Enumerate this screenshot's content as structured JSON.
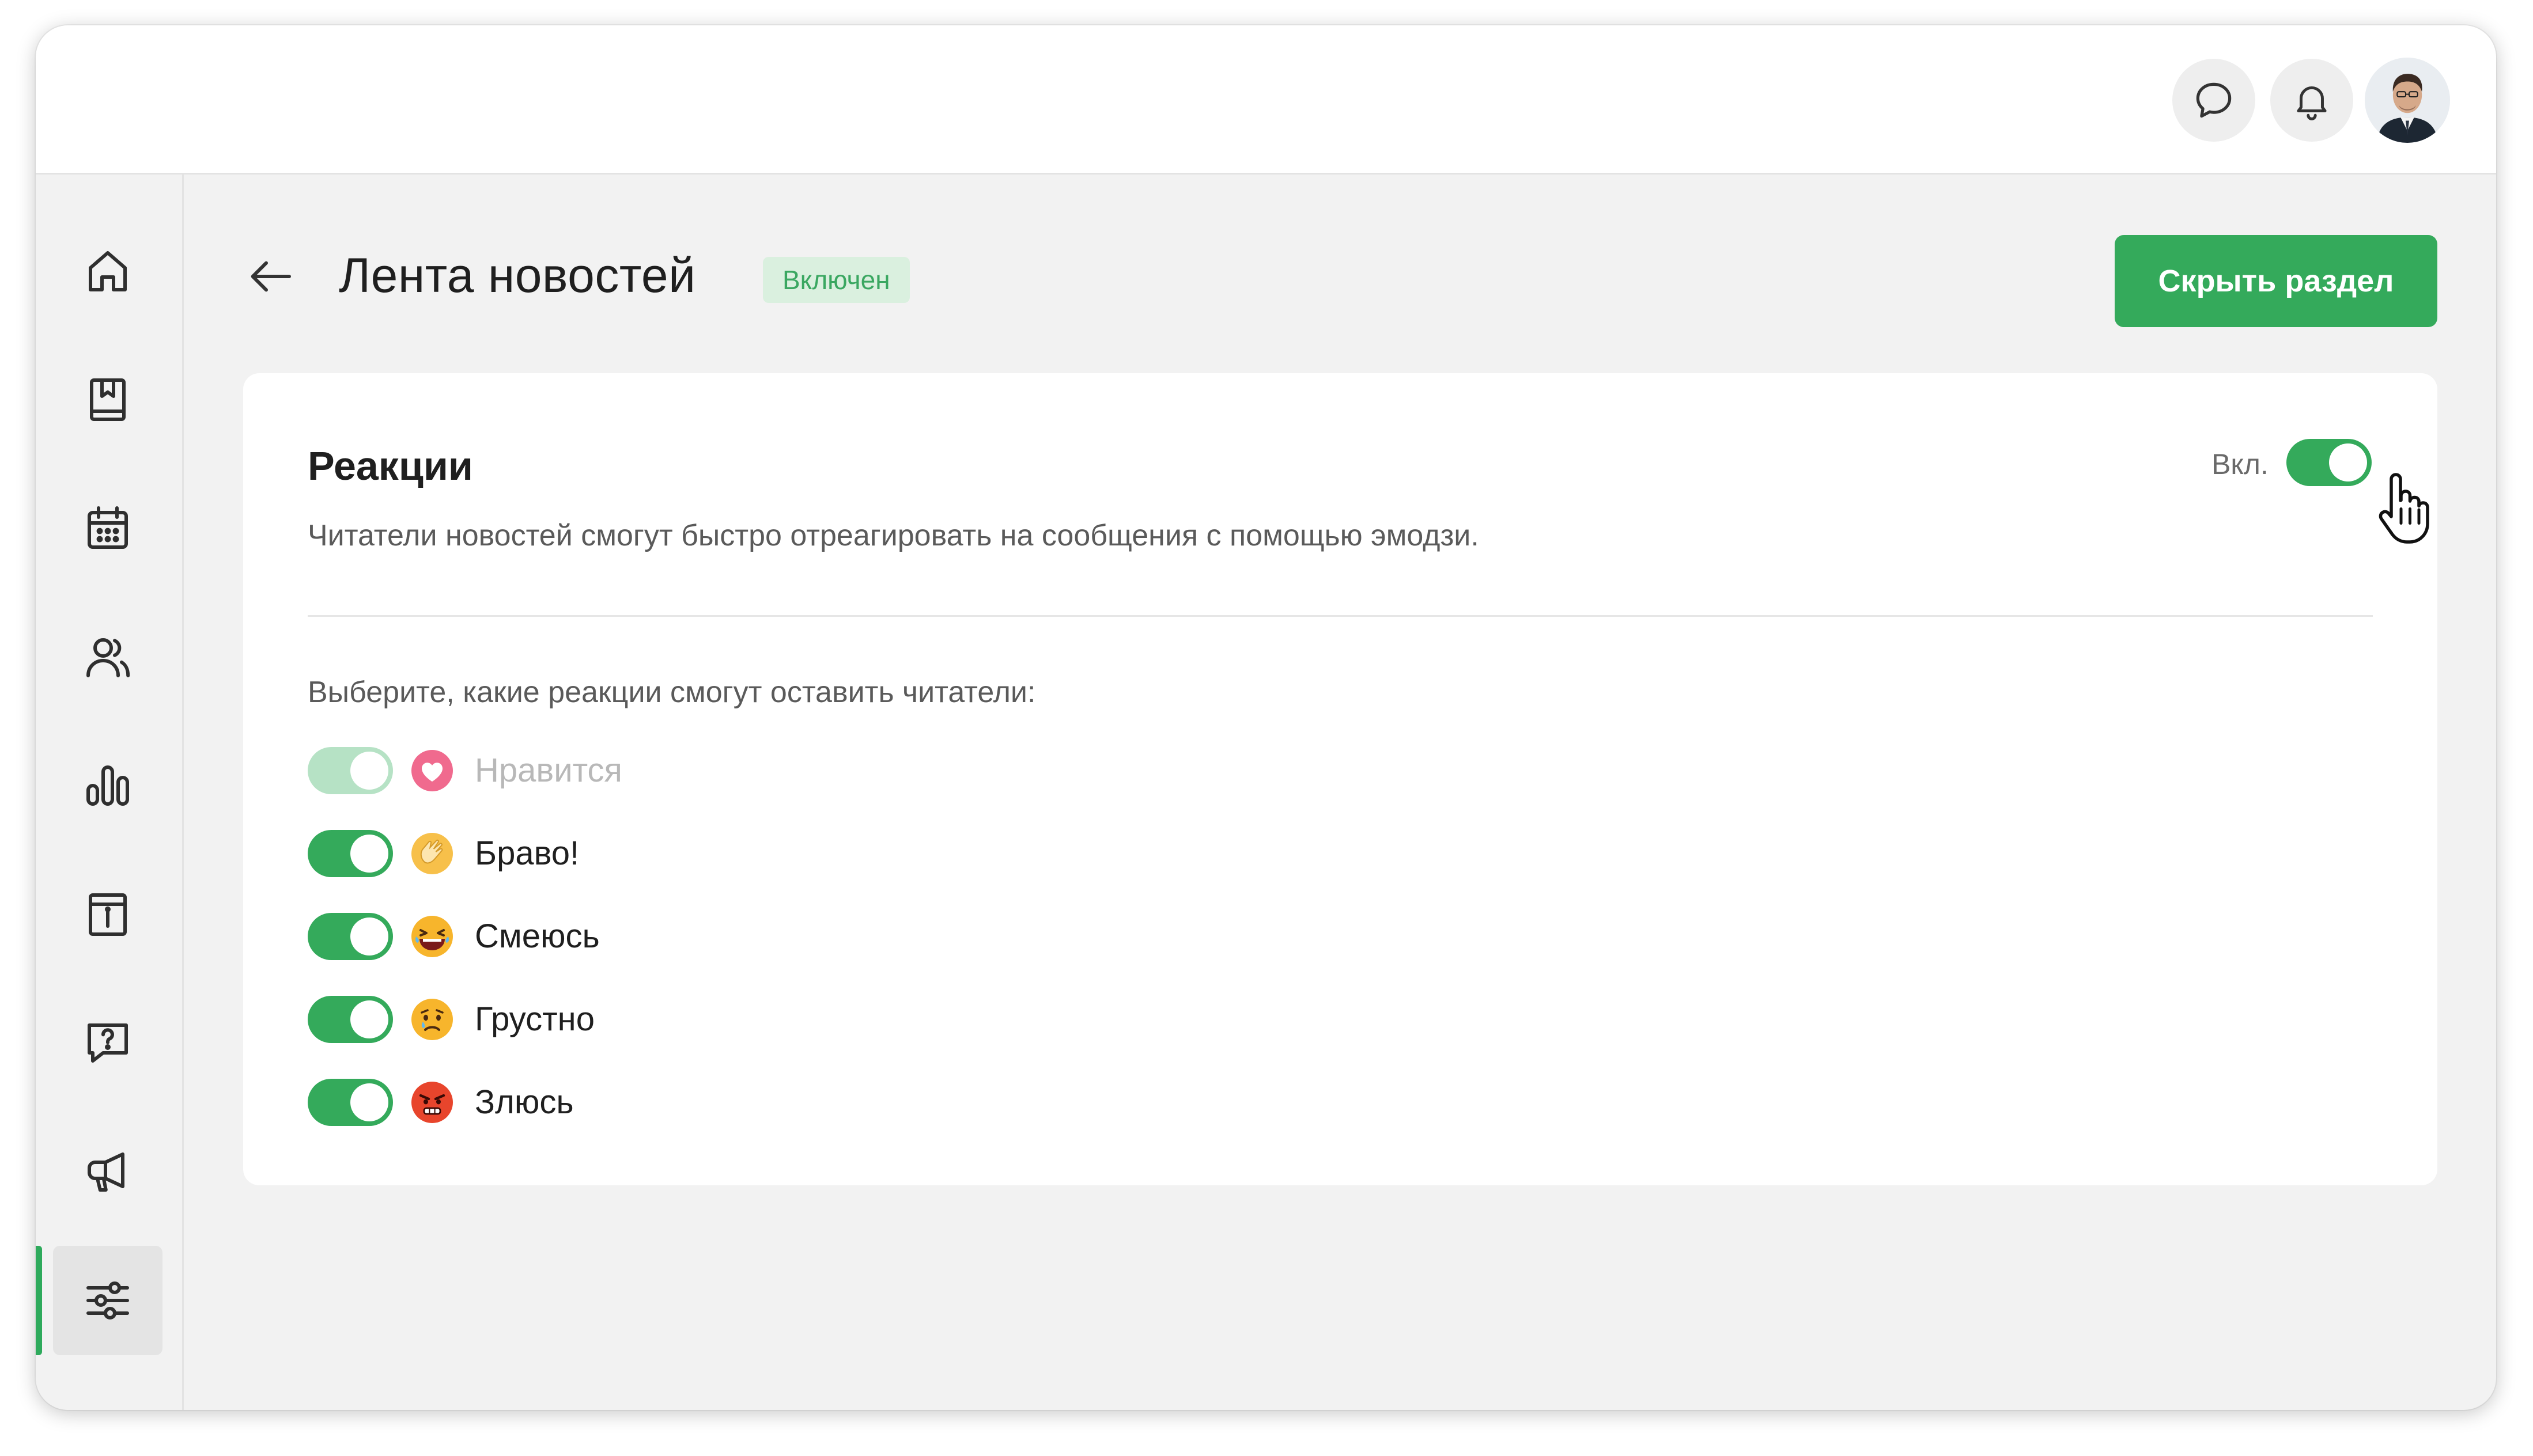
{
  "header": {
    "chat_icon": "chat-bubble-icon",
    "notifications_icon": "bell-icon",
    "avatar": "user-avatar"
  },
  "sidebar": {
    "items": [
      {
        "icon": "home-icon",
        "active": false
      },
      {
        "icon": "book-icon",
        "active": false
      },
      {
        "icon": "calendar-icon",
        "active": false
      },
      {
        "icon": "users-icon",
        "active": false
      },
      {
        "icon": "bar-chart-icon",
        "active": false
      },
      {
        "icon": "info-icon",
        "active": false
      },
      {
        "icon": "help-chat-icon",
        "active": false
      },
      {
        "icon": "megaphone-icon",
        "active": false
      },
      {
        "icon": "sliders-icon",
        "active": true
      }
    ]
  },
  "page": {
    "title": "Лента новостей",
    "status_badge": "Включен",
    "hide_button": "Скрыть раздел"
  },
  "reactions_card": {
    "title": "Реакции",
    "description": "Читатели новостей смогут быстро отреагировать на сообщения с помощью эмодзи.",
    "toggle_label": "Вкл.",
    "toggle_on": true,
    "hint": "Выберите, какие реакции смогут оставить читатели:",
    "items": [
      {
        "label": "Нравится",
        "emoji": "heart-emoji",
        "enabled": true,
        "disabled": true
      },
      {
        "label": "Браво!",
        "emoji": "clapping-emoji",
        "enabled": true,
        "disabled": false
      },
      {
        "label": "Смеюсь",
        "emoji": "laughing-emoji",
        "enabled": true,
        "disabled": false
      },
      {
        "label": "Грустно",
        "emoji": "sad-emoji",
        "enabled": true,
        "disabled": false
      },
      {
        "label": "Злюсь",
        "emoji": "angry-emoji",
        "enabled": true,
        "disabled": false
      }
    ]
  },
  "colors": {
    "accent": "#34aa5b",
    "badge_bg": "#daf0df",
    "badge_text": "#3aa761"
  }
}
